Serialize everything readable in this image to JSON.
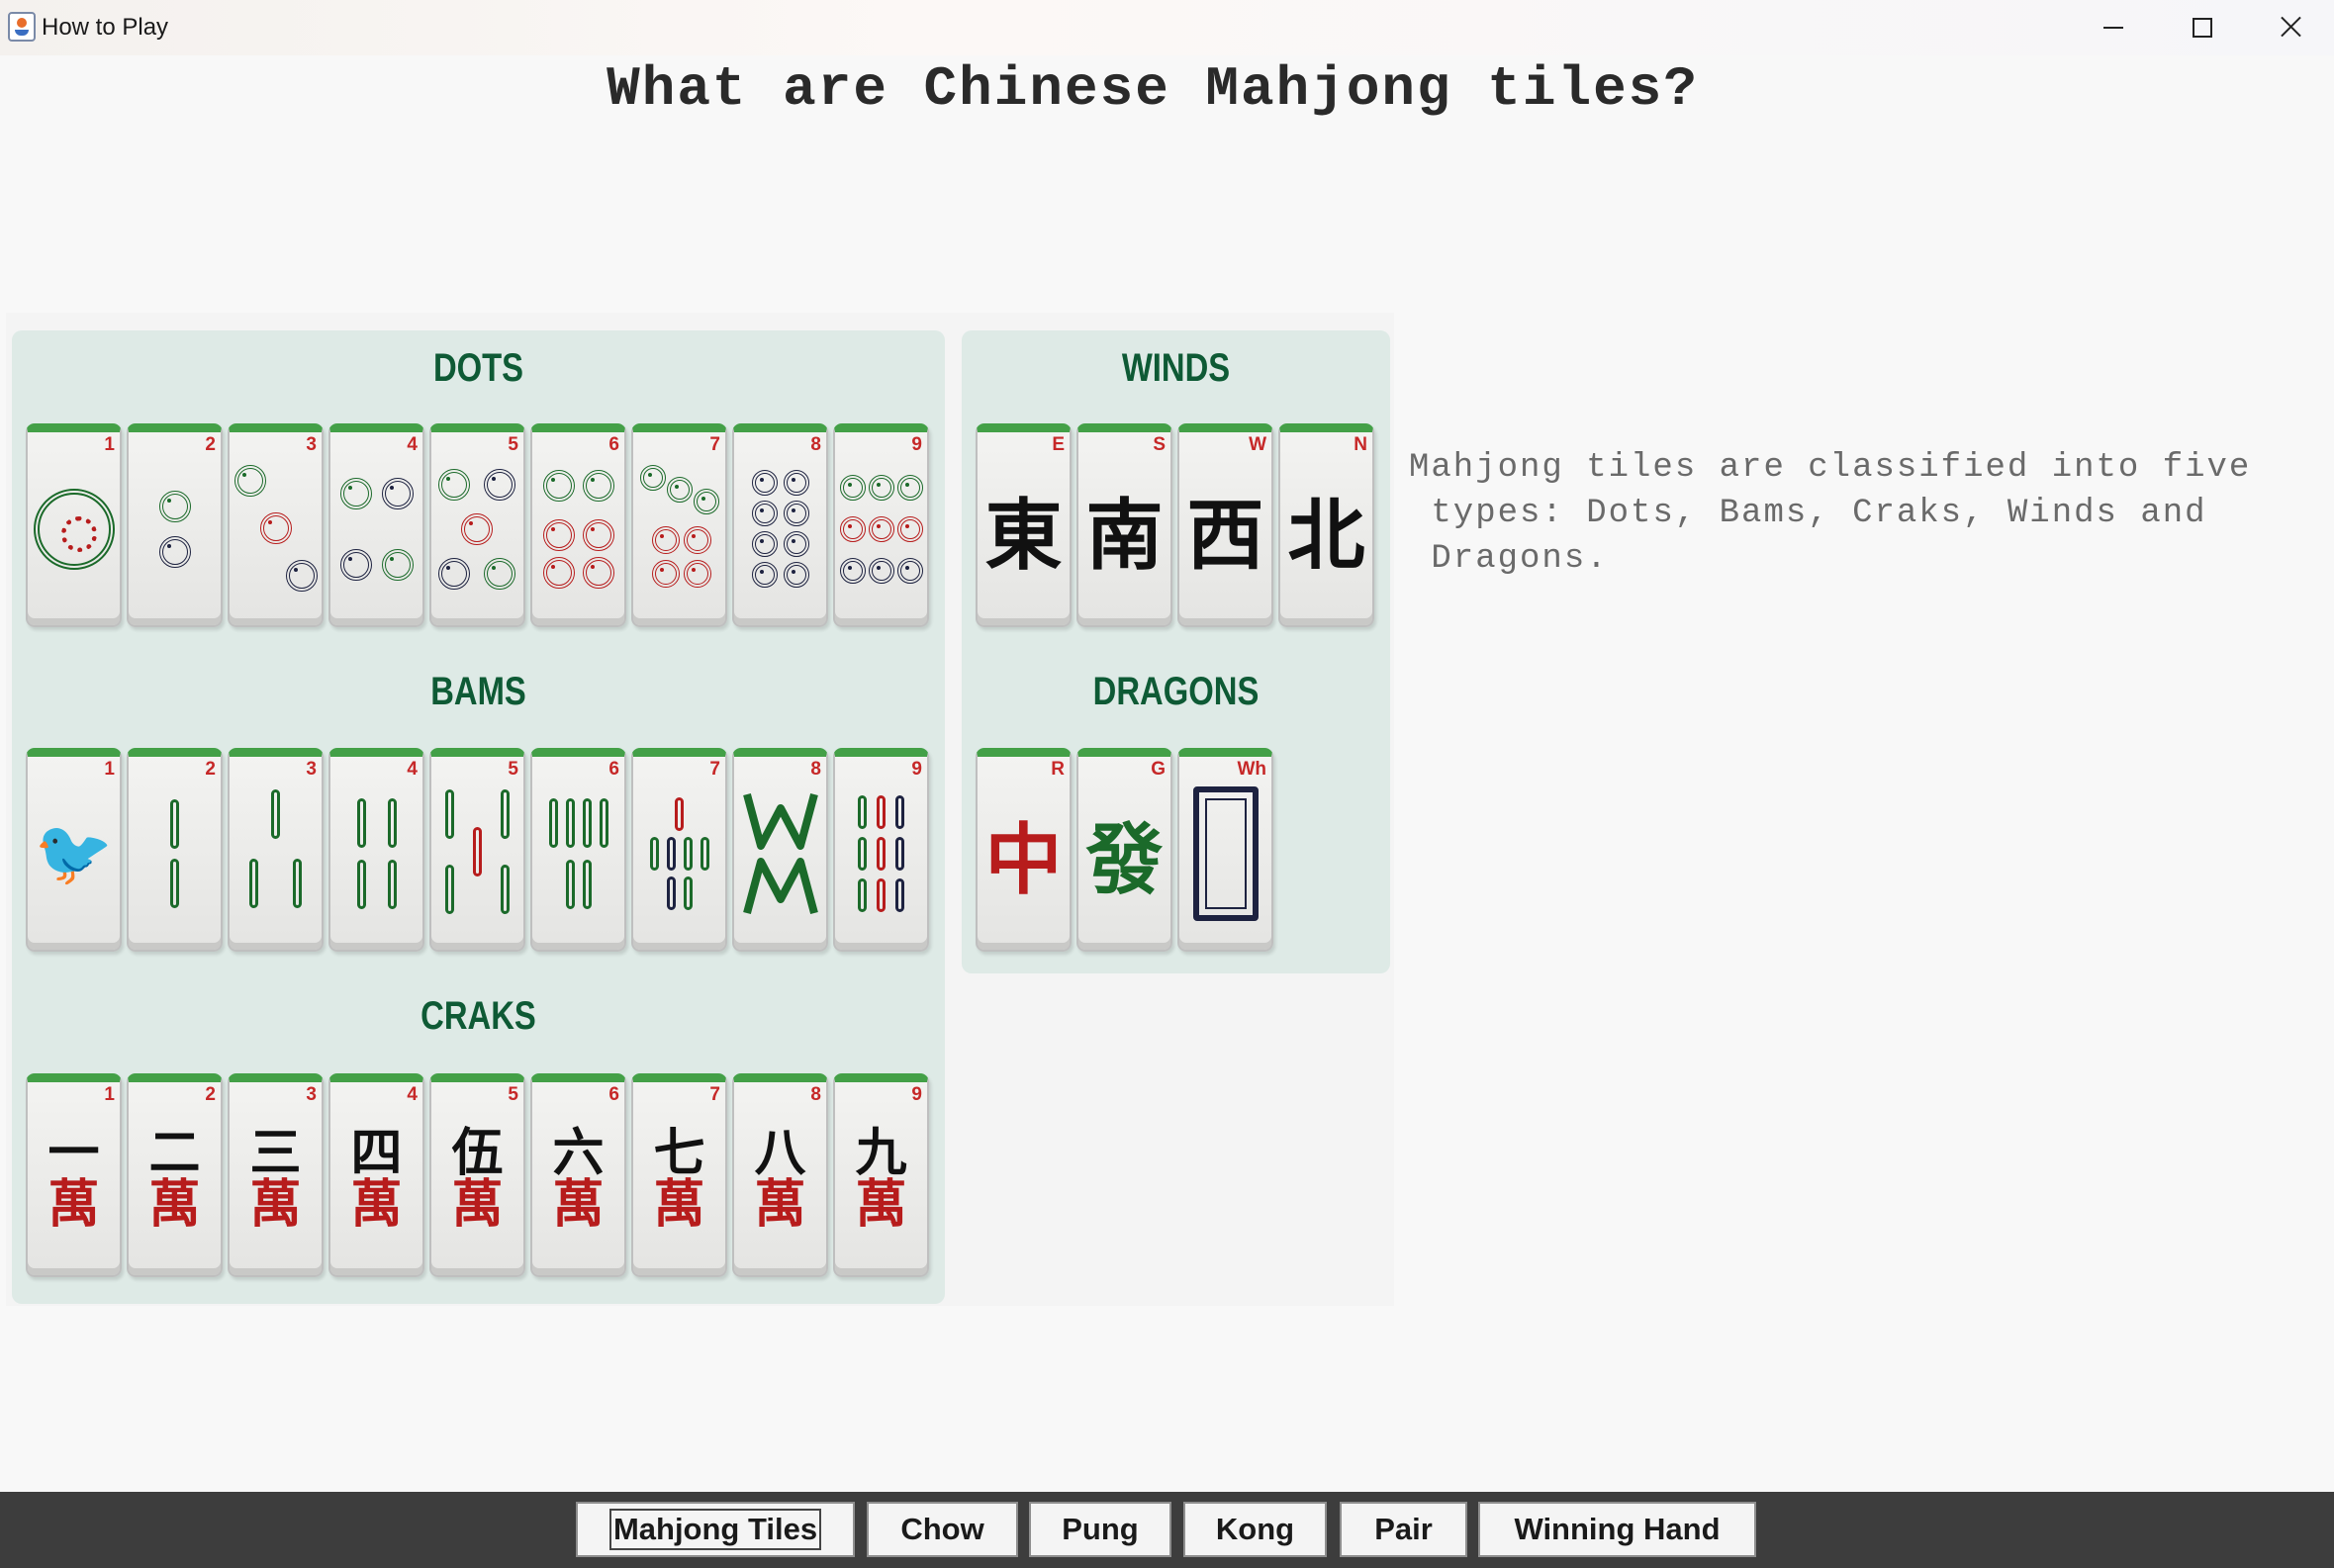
{
  "window": {
    "title": "How to Play"
  },
  "page_title": "What are Chinese Mahjong tiles?",
  "description": "Mahjong tiles are classified into five\n types: Dots, Bams, Craks, Winds and\n Dragons.",
  "sections": {
    "dots": {
      "label": "DOTS",
      "indices": [
        "1",
        "2",
        "3",
        "4",
        "5",
        "6",
        "7",
        "8",
        "9"
      ]
    },
    "bams": {
      "label": "BAMS",
      "indices": [
        "1",
        "2",
        "3",
        "4",
        "5",
        "6",
        "7",
        "8",
        "9"
      ]
    },
    "craks": {
      "label": "CRAKS",
      "indices": [
        "1",
        "2",
        "3",
        "4",
        "5",
        "6",
        "7",
        "8",
        "9"
      ],
      "numerals": [
        "一",
        "二",
        "三",
        "四",
        "伍",
        "六",
        "七",
        "八",
        "九"
      ],
      "suit_glyph": "萬"
    },
    "winds": {
      "label": "WINDS",
      "indices": [
        "E",
        "S",
        "W",
        "N"
      ],
      "glyphs": [
        "東",
        "南",
        "西",
        "北"
      ]
    },
    "dragons": {
      "label": "DRAGONS",
      "indices": [
        "R",
        "G",
        "Wh"
      ],
      "glyphs": [
        "中",
        "發",
        ""
      ]
    }
  },
  "nav": {
    "buttons": [
      "Mahjong Tiles",
      "Chow",
      "Pung",
      "Kong",
      "Pair",
      "Winning Hand"
    ],
    "active": "Mahjong Tiles"
  },
  "colors": {
    "bamboo_green": "#1b6a2a",
    "crak_red": "#b71c1c",
    "dot_navy": "#1d2240",
    "tile_top": "#43a047",
    "panel": "#deeae6"
  }
}
